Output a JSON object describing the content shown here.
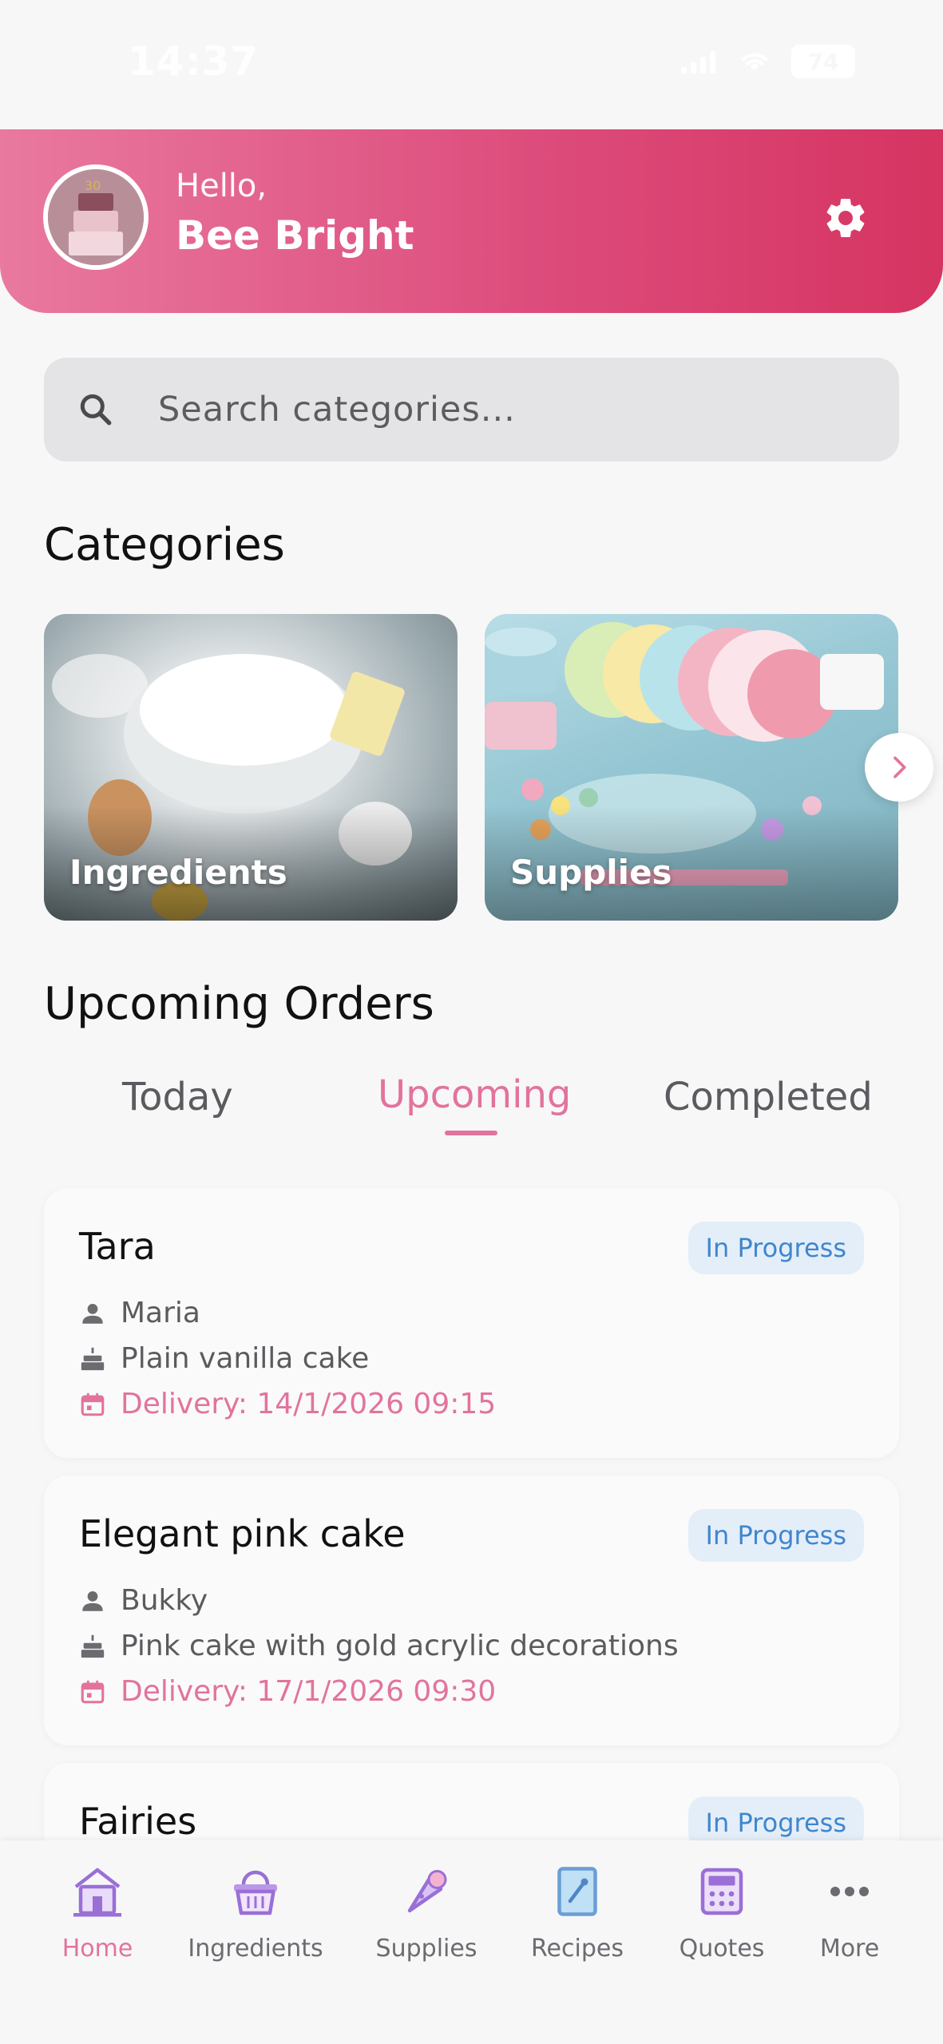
{
  "status_bar": {
    "time": "14:37",
    "battery": "74"
  },
  "header": {
    "greeting": "Hello,",
    "user_name": "Bee Bright",
    "settings_icon": "gear-icon",
    "gradient_start": "#e9799f",
    "gradient_end": "#d63461"
  },
  "search": {
    "placeholder": "Search categories..."
  },
  "categories": {
    "title": "Categories",
    "items": [
      {
        "label": "Ingredients"
      },
      {
        "label": "Supplies"
      }
    ]
  },
  "orders": {
    "title": "Upcoming Orders",
    "tabs": [
      {
        "label": "Today",
        "active": false
      },
      {
        "label": "Upcoming",
        "active": true
      },
      {
        "label": "Completed",
        "active": false
      }
    ],
    "items": [
      {
        "title": "Tara",
        "status": "In Progress",
        "customer": "Maria",
        "description": "Plain vanilla cake",
        "delivery": "Delivery: 14/1/2026  09:15"
      },
      {
        "title": "Elegant pink cake",
        "status": "In Progress",
        "customer": "Bukky",
        "description": "Pink cake with gold acrylic decorations",
        "delivery": "Delivery: 17/1/2026  09:30"
      },
      {
        "title": "Fairies",
        "status": "In Progress"
      }
    ]
  },
  "bottom_nav": {
    "items": [
      {
        "label": "Home",
        "icon": "home-icon",
        "active": true
      },
      {
        "label": "Ingredients",
        "icon": "basket-icon",
        "active": false
      },
      {
        "label": "Supplies",
        "icon": "piping-bag-icon",
        "active": false
      },
      {
        "label": "Recipes",
        "icon": "recipe-book-icon",
        "active": false
      },
      {
        "label": "Quotes",
        "icon": "calculator-icon",
        "active": false
      },
      {
        "label": "More",
        "icon": "more-dots-icon",
        "active": false
      }
    ]
  },
  "colors": {
    "accent": "#e2739d",
    "status_badge_bg": "#e4eef8",
    "status_badge_text": "#3f86cf"
  }
}
